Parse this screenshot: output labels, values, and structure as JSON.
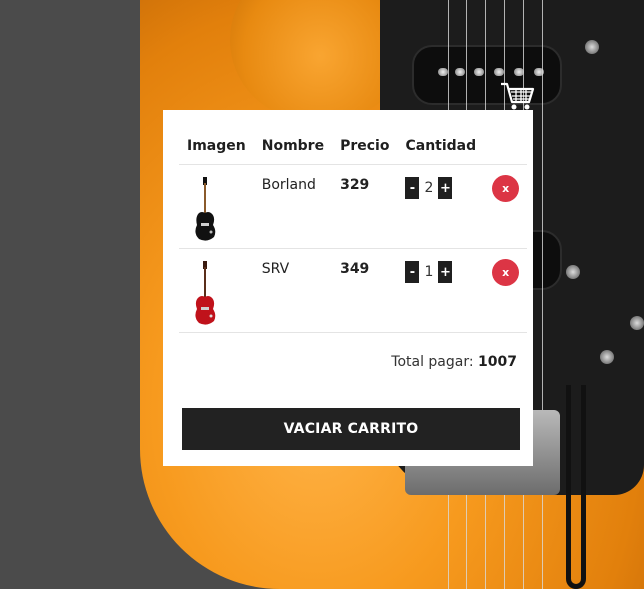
{
  "cart": {
    "headers": {
      "image": "Imagen",
      "name": "Nombre",
      "price": "Precio",
      "quantity": "Cantidad"
    },
    "items": [
      {
        "name": "Borland",
        "price": "329",
        "quantity": "2",
        "thumb_color": "#111111",
        "decrement_label": "-",
        "increment_label": "+",
        "remove_label": "x"
      },
      {
        "name": "SRV",
        "price": "349",
        "quantity": "1",
        "thumb_color": "#c0121b",
        "decrement_label": "-",
        "increment_label": "+",
        "remove_label": "x"
      }
    ],
    "total_label": "Total pagar:",
    "total_value": "1007",
    "empty_button_label": "VACIAR CARRITO"
  },
  "icons": {
    "cart": "shopping-cart-icon"
  },
  "colors": {
    "remove_button": "#dc3545",
    "dark_button": "#222222",
    "background": "#4b4b4b",
    "guitar_orange": "#f79a1e"
  }
}
